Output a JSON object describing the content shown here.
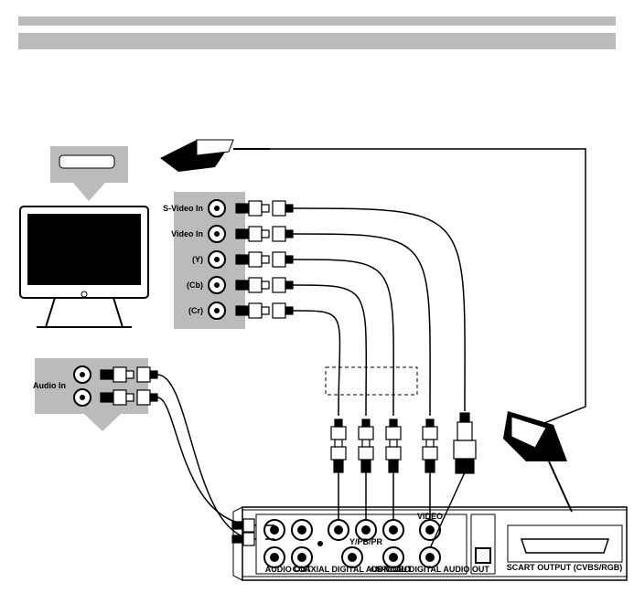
{
  "labels": {
    "svideo": "S-Video In",
    "video": "Video In",
    "y": "(Y)",
    "cb": "(Cb)",
    "cr": "(Cr)",
    "audio": "Audio In",
    "back_audio": "AUDIO OUT",
    "back_video": "VIDEO OUT",
    "back_coax": "COAXIAL DIGITAL AUDIO OUT",
    "back_svid": "S-VIDEO",
    "back_opt": "OPTICAL DIGITAL AUDIO OUT",
    "back_scart": "SCART OUTPUT (CVBS/RGB)",
    "back_group": "Y/PB/PR"
  }
}
